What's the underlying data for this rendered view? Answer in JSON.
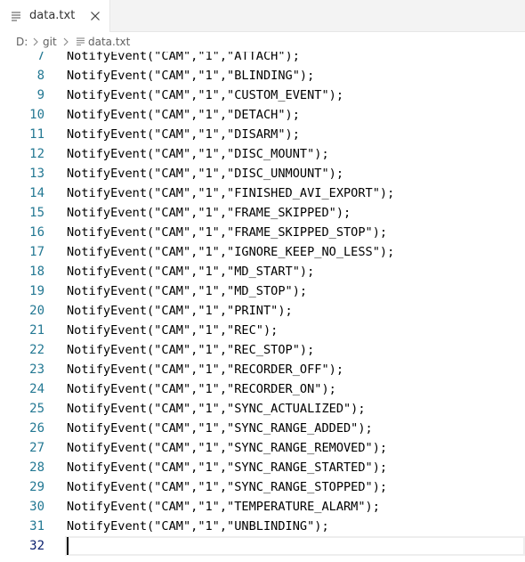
{
  "tab": {
    "label": "data.txt",
    "file_icon": "file-lines-icon",
    "close_icon": "close-icon"
  },
  "breadcrumb": {
    "drive": "D:",
    "folder": "git",
    "file": "data.txt",
    "separator_icon": "chevron-right-icon"
  },
  "editor": {
    "active_line": 32,
    "lines": [
      {
        "num": "7",
        "text": "NotifyEvent(\"CAM\",\"1\",\"ATTACH\");"
      },
      {
        "num": "8",
        "text": "NotifyEvent(\"CAM\",\"1\",\"BLINDING\");"
      },
      {
        "num": "9",
        "text": "NotifyEvent(\"CAM\",\"1\",\"CUSTOM_EVENT\");"
      },
      {
        "num": "10",
        "text": "NotifyEvent(\"CAM\",\"1\",\"DETACH\");"
      },
      {
        "num": "11",
        "text": "NotifyEvent(\"CAM\",\"1\",\"DISARM\");"
      },
      {
        "num": "12",
        "text": "NotifyEvent(\"CAM\",\"1\",\"DISC_MOUNT\");"
      },
      {
        "num": "13",
        "text": "NotifyEvent(\"CAM\",\"1\",\"DISC_UNMOUNT\");"
      },
      {
        "num": "14",
        "text": "NotifyEvent(\"CAM\",\"1\",\"FINISHED_AVI_EXPORT\");"
      },
      {
        "num": "15",
        "text": "NotifyEvent(\"CAM\",\"1\",\"FRAME_SKIPPED\");"
      },
      {
        "num": "16",
        "text": "NotifyEvent(\"CAM\",\"1\",\"FRAME_SKIPPED_STOP\");"
      },
      {
        "num": "17",
        "text": "NotifyEvent(\"CAM\",\"1\",\"IGNORE_KEEP_NO_LESS\");"
      },
      {
        "num": "18",
        "text": "NotifyEvent(\"CAM\",\"1\",\"MD_START\");"
      },
      {
        "num": "19",
        "text": "NotifyEvent(\"CAM\",\"1\",\"MD_STOP\");"
      },
      {
        "num": "20",
        "text": "NotifyEvent(\"CAM\",\"1\",\"PRINT\");"
      },
      {
        "num": "21",
        "text": "NotifyEvent(\"CAM\",\"1\",\"REC\");"
      },
      {
        "num": "22",
        "text": "NotifyEvent(\"CAM\",\"1\",\"REC_STOP\");"
      },
      {
        "num": "23",
        "text": "NotifyEvent(\"CAM\",\"1\",\"RECORDER_OFF\");"
      },
      {
        "num": "24",
        "text": "NotifyEvent(\"CAM\",\"1\",\"RECORDER_ON\");"
      },
      {
        "num": "25",
        "text": "NotifyEvent(\"CAM\",\"1\",\"SYNC_ACTUALIZED\");"
      },
      {
        "num": "26",
        "text": "NotifyEvent(\"CAM\",\"1\",\"SYNC_RANGE_ADDED\");"
      },
      {
        "num": "27",
        "text": "NotifyEvent(\"CAM\",\"1\",\"SYNC_RANGE_REMOVED\");"
      },
      {
        "num": "28",
        "text": "NotifyEvent(\"CAM\",\"1\",\"SYNC_RANGE_STARTED\");"
      },
      {
        "num": "29",
        "text": "NotifyEvent(\"CAM\",\"1\",\"SYNC_RANGE_STOPPED\");"
      },
      {
        "num": "30",
        "text": "NotifyEvent(\"CAM\",\"1\",\"TEMPERATURE_ALARM\");"
      },
      {
        "num": "31",
        "text": "NotifyEvent(\"CAM\",\"1\",\"UNBLINDING\");"
      },
      {
        "num": "32",
        "text": ""
      }
    ]
  }
}
